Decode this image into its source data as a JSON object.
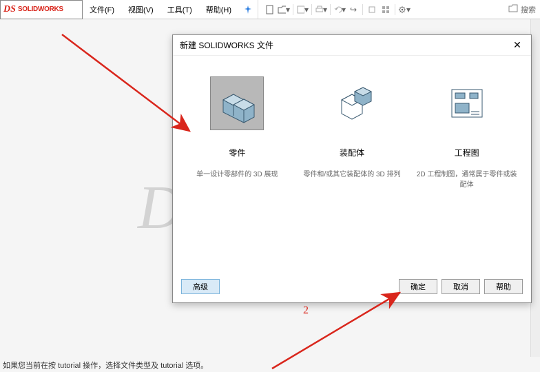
{
  "app": {
    "brand": "SOLIDWORKS",
    "brand_glyph": "DS"
  },
  "menu": {
    "file": "文件(F)",
    "view": "视图(V)",
    "tools": "工具(T)",
    "help": "帮助(H)"
  },
  "search": {
    "label": "搜索"
  },
  "dialog": {
    "title": "新建 SOLIDWORKS 文件",
    "options": {
      "part": {
        "title": "零件",
        "desc": "单一设计零部件的 3D 展现"
      },
      "assembly": {
        "title": "装配体",
        "desc": "零件和/或其它装配体的 3D 排列"
      },
      "drawing": {
        "title": "工程图",
        "desc": "2D 工程制图，通常属于零件或装配体"
      }
    },
    "buttons": {
      "advanced": "高级",
      "ok": "确定",
      "cancel": "取消",
      "help": "帮助"
    }
  },
  "annotations": {
    "num2": "2"
  },
  "status": "如果您当前在按 tutorial 操作，选择文件类型及 tutorial 选项。"
}
